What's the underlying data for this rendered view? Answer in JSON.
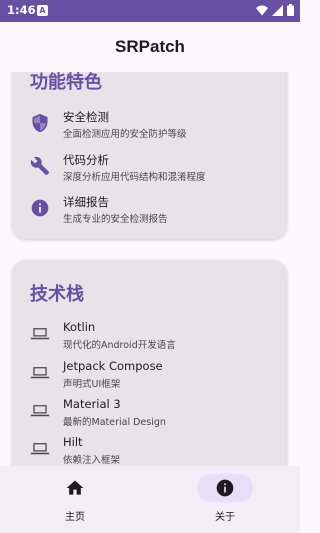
{
  "status_bar": {
    "time": "1:46",
    "notification_icon": "A"
  },
  "app_bar": {
    "title": "SRPatch"
  },
  "features_card": {
    "title": "功能特色",
    "items": [
      {
        "icon": "shield-icon",
        "title": "安全检测",
        "desc": "全面检测应用的安全防护等级"
      },
      {
        "icon": "wrench-icon",
        "title": "代码分析",
        "desc": "深度分析应用代码结构和混淆程度"
      },
      {
        "icon": "info-icon",
        "title": "详细报告",
        "desc": "生成专业的安全检测报告"
      }
    ]
  },
  "tech_card": {
    "title": "技术栈",
    "items": [
      {
        "icon": "laptop-icon",
        "title": "Kotlin",
        "desc": "现代化的Android开发语言"
      },
      {
        "icon": "laptop-icon",
        "title": "Jetpack Compose",
        "desc": "声明式UI框架"
      },
      {
        "icon": "laptop-icon",
        "title": "Material 3",
        "desc": "最新的Material Design"
      },
      {
        "icon": "laptop-icon",
        "title": "Hilt",
        "desc": "依赖注入框架"
      }
    ]
  },
  "bottom_nav": {
    "items": [
      {
        "icon": "home-icon",
        "label": "主页",
        "active": false
      },
      {
        "icon": "info-icon",
        "label": "关于",
        "active": true
      }
    ]
  },
  "colors": {
    "accent": "#6750a4",
    "card_bg": "#e8e3e9",
    "nav_bg": "#f3edf7",
    "active_pill": "#e8def8"
  }
}
